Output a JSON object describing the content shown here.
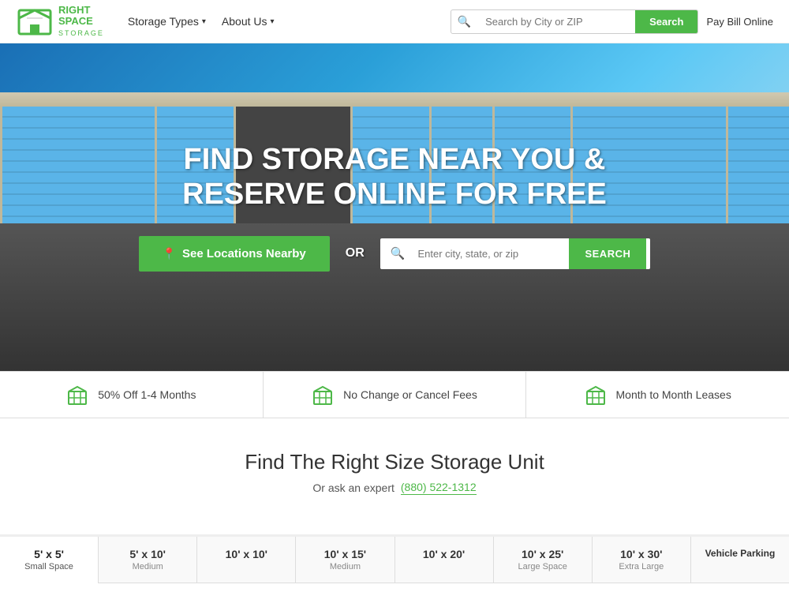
{
  "header": {
    "logo": {
      "line1": "RIGHT",
      "line2": "SPACE",
      "line3": "STORAGE"
    },
    "nav": [
      {
        "label": "Storage Types",
        "has_dropdown": true
      },
      {
        "label": "About Us",
        "has_dropdown": true
      }
    ],
    "search": {
      "placeholder": "Search by City or ZIP",
      "button_label": "Search"
    },
    "pay_bill_label": "Pay Bill Online"
  },
  "hero": {
    "title": "FIND STORAGE NEAR YOU & RESERVE ONLINE FOR FREE",
    "locations_button": "See Locations Nearby",
    "or_text": "OR",
    "search_placeholder": "Enter city, state, or zip",
    "search_button": "SEARCH"
  },
  "benefits": [
    {
      "icon": "box-icon",
      "text": "50% Off 1-4 Months"
    },
    {
      "icon": "box-icon",
      "text": "No Change or Cancel Fees"
    },
    {
      "icon": "box-icon",
      "text": "Month to Month Leases"
    }
  ],
  "storage_section": {
    "title": "Find The Right Size Storage Unit",
    "subtitle": "Or ask an expert",
    "phone": "(880) 522-1312"
  },
  "size_tabs": [
    {
      "size": "5' x 5'",
      "label": "Small Space",
      "active": true
    },
    {
      "size": "5' x 10'",
      "label": "Medium",
      "active": false
    },
    {
      "size": "10' x 10'",
      "label": "",
      "active": false
    },
    {
      "size": "10' x 15'",
      "label": "Medium",
      "active": false
    },
    {
      "size": "10' x 20'",
      "label": "",
      "active": false
    },
    {
      "size": "10' x 25'",
      "label": "Large Space",
      "active": false
    },
    {
      "size": "10' x 30'",
      "label": "Extra Large",
      "active": false
    },
    {
      "size": "Vehicle Parking",
      "label": "",
      "active": false
    }
  ]
}
